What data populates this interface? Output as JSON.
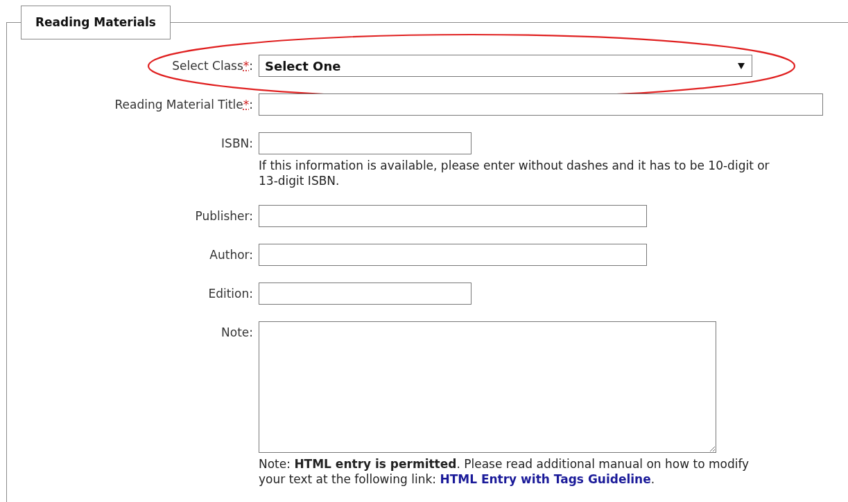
{
  "section": {
    "title": "Reading Materials"
  },
  "fields": [
    {
      "label": "Select Class",
      "required": true,
      "kind": "select",
      "value": "Select One",
      "highlighted": true
    },
    {
      "label": "Reading Material Title",
      "required": true,
      "kind": "text",
      "highlighted": false
    },
    {
      "label": "ISBN",
      "required": false,
      "kind": "text",
      "hint": "If this information is available, please enter without dashes and it has to be 10-digit or 13-digit ISBN.",
      "highlighted": false
    },
    {
      "label": "Publisher",
      "required": false,
      "kind": "text",
      "highlighted": false
    },
    {
      "label": "Author",
      "required": false,
      "kind": "text",
      "highlighted": false
    },
    {
      "label": "Edition",
      "required": false,
      "kind": "text",
      "highlighted": false
    },
    {
      "label": "Note",
      "required": false,
      "kind": "textarea",
      "hint": "Note: **HTML entry is permitted**. Please read additional manual on how to modify your text at the following link: ",
      "link": "HTML Entry with Tags Guideline",
      "hint_end": ".",
      "highlighted": false
    }
  ],
  "required_mark": "*",
  "label_suffix": ":"
}
